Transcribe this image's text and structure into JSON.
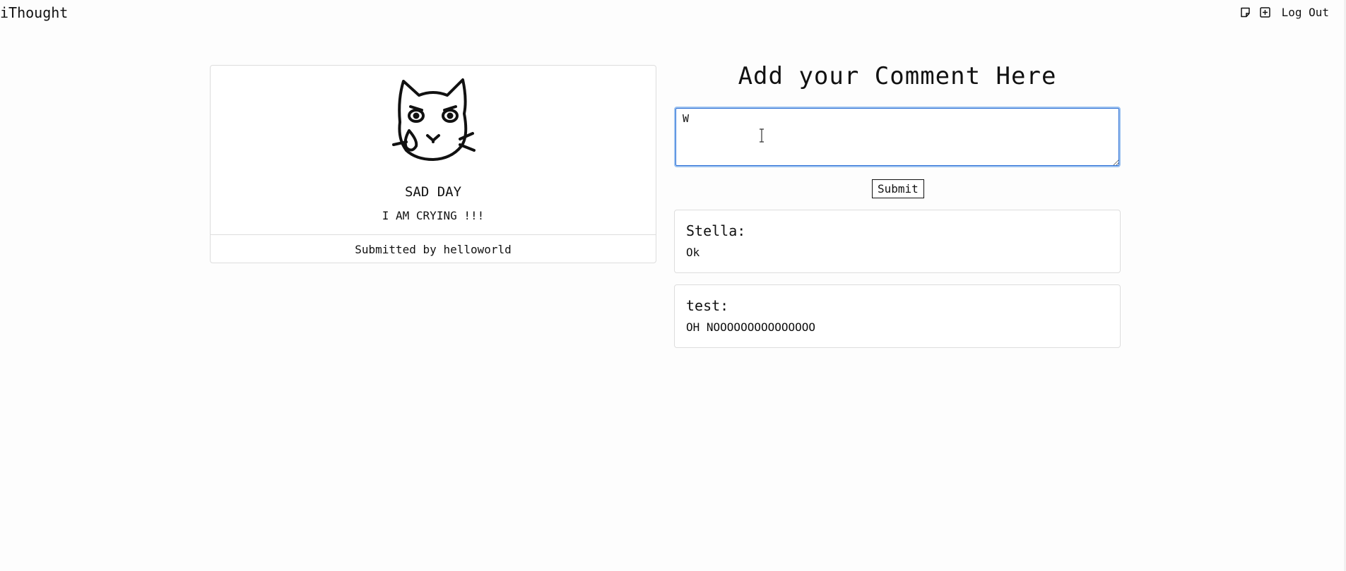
{
  "header": {
    "brand": "iThought",
    "icons": [
      "note-icon",
      "add-square-icon"
    ],
    "logout_label": "Log Out"
  },
  "post": {
    "image_icon": "crying-cat-icon",
    "title": "SAD DAY",
    "body": "I AM CRYING !!!",
    "submitted_by": "Submitted by helloworld"
  },
  "comment_form": {
    "heading": "Add your Comment Here",
    "input_value": "W",
    "submit_label": "Submit"
  },
  "comments": [
    {
      "author": "Stella:",
      "text": "Ok"
    },
    {
      "author": "test:",
      "text": "OH NOOOOOOOOOOOOOOO"
    }
  ],
  "colors": {
    "focus_ring": "#9ec3f0",
    "border": "#dddddd"
  }
}
